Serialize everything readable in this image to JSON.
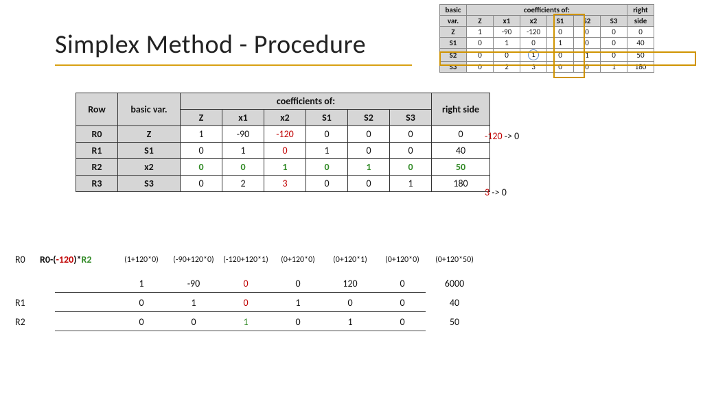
{
  "title": "Simplex Method - Procedure",
  "small_table": {
    "head1_l": "basic",
    "head1_c": "coefficients of:",
    "head1_r": "right",
    "head2": [
      "var.",
      "Z",
      "x1",
      "x2",
      "S1",
      "S2",
      "S3",
      "side"
    ],
    "rows": [
      {
        "bv": "Z",
        "c": [
          "1",
          "-90",
          "-120",
          "0",
          "0",
          "0"
        ],
        "r": "0"
      },
      {
        "bv": "S1",
        "c": [
          "0",
          "1",
          "0",
          "1",
          "0",
          "0"
        ],
        "r": "40"
      },
      {
        "bv": "S2",
        "c": [
          "0",
          "0",
          "1",
          "0",
          "1",
          "0"
        ],
        "r": "50"
      },
      {
        "bv": "S3",
        "c": [
          "0",
          "2",
          "3",
          "0",
          "0",
          "1"
        ],
        "r": "180"
      }
    ]
  },
  "main_table": {
    "head_row": "Row",
    "head_bv": "basic var.",
    "head_coeff": "coefficients of:",
    "head_cols": [
      "Z",
      "x1",
      "x2",
      "S1",
      "S2",
      "S3"
    ],
    "head_rs": "right side",
    "rows": [
      {
        "row": "R0",
        "bv": "Z",
        "c": [
          "1",
          "-90",
          "-120",
          "0",
          "0",
          "0"
        ],
        "r": "0"
      },
      {
        "row": "R1",
        "bv": "S1",
        "c": [
          "0",
          "1",
          "0",
          "1",
          "0",
          "0"
        ],
        "r": "40"
      },
      {
        "row": "R2",
        "bv": "x2",
        "c": [
          "0",
          "0",
          "1",
          "0",
          "1",
          "0"
        ],
        "r": "50"
      },
      {
        "row": "R3",
        "bv": "S3",
        "c": [
          "0",
          "2",
          "3",
          "0",
          "0",
          "1"
        ],
        "r": "180"
      }
    ]
  },
  "note0_a": "-120",
  "note0_b": " -> 0",
  "note3_a": "3",
  "note3_b": " -> 0",
  "calc": {
    "l0": "R0",
    "expr_a": "R0-(",
    "expr_b": "-120",
    "expr_c": ")*",
    "expr_d": "R2",
    "detail": [
      "(1+120*0)",
      "(-90+120*0)",
      "(-120+120*1)",
      "(0+120*0)",
      "(0+120*1)",
      "(0+120*0)",
      "(0+120*50)"
    ],
    "r0": [
      "1",
      "-90",
      "0",
      "0",
      "120",
      "0",
      "6000"
    ],
    "l1": "R1",
    "r1": [
      "0",
      "1",
      "0",
      "1",
      "0",
      "0",
      "40"
    ],
    "l2": "R2",
    "r2": [
      "0",
      "0",
      "1",
      "0",
      "1",
      "0",
      "50"
    ]
  }
}
